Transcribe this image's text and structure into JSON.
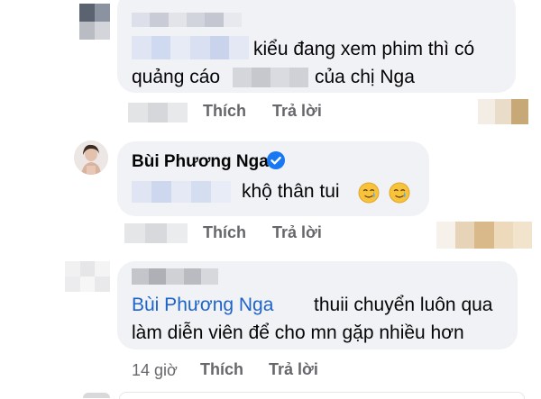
{
  "comments": [
    {
      "text_line1": "kiểu đang xem phim thì có",
      "text_line2a": "quảng cáo",
      "text_line2b": "của chị Nga",
      "like_label": "Thích",
      "reply_label": "Trả lời"
    },
    {
      "author": "Bùi Phương Nga",
      "verified": true,
      "text": "khộ thân tui",
      "emoji": "🥲🥲",
      "like_label": "Thích",
      "reply_label": "Trả lời"
    },
    {
      "mention": "Bùi Phương Nga",
      "text_line1": "thuii chuyển luôn qua",
      "text_line2": "làm diễn viên để cho mn gặp nhiều hơn",
      "time": "14 giờ",
      "like_label": "Thích",
      "reply_label": "Trả lời"
    }
  ],
  "colors": {
    "bubble": "#f0f2f5",
    "mention": "#1d63c9",
    "meta": "#65676b",
    "verified": "#1877f2"
  },
  "icons": [
    "verified-badge-icon",
    "crying-smile-emoji"
  ]
}
